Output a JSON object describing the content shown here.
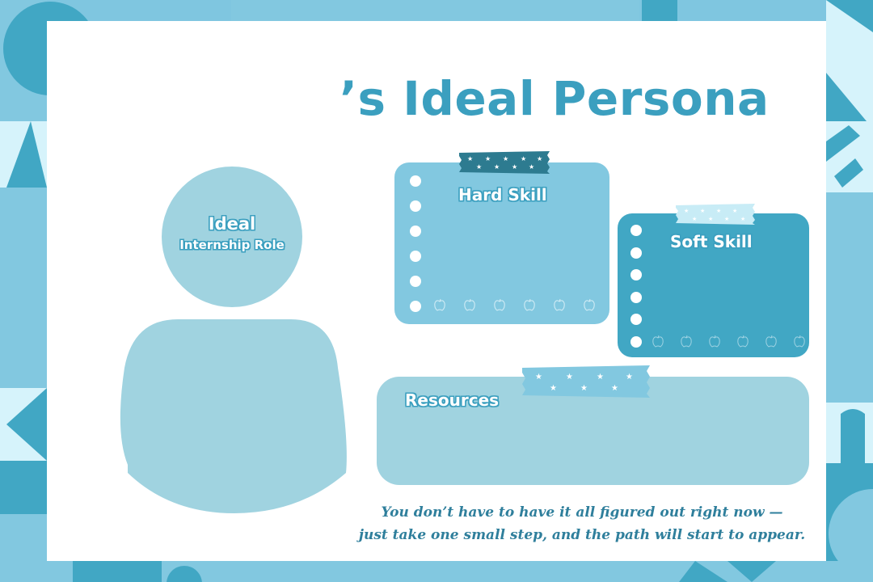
{
  "title": "’s Ideal Persona",
  "persona": {
    "head_line1": "Ideal",
    "head_line2": "Internship Role"
  },
  "notes": {
    "hard_skill": "Hard Skill",
    "soft_skill": "Soft Skill",
    "resources": "Resources"
  },
  "quote": {
    "line1": "You don’t have to have it all figured out right now —",
    "line2": "just take one small step, and the path will start to appear."
  },
  "colors": {
    "accent": "#3b9fbf",
    "light_blue": "#82c8e0",
    "teal": "#41a7c4",
    "pale": "#a0d3e0",
    "background": "#d6f3fb"
  }
}
